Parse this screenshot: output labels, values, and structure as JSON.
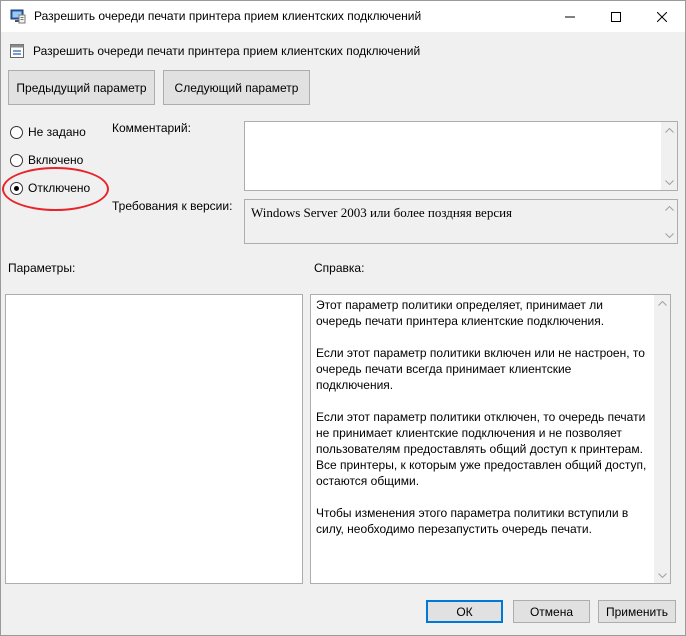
{
  "window": {
    "title": "Разрешить очереди печати принтера прием клиентских подключений"
  },
  "setting": {
    "name": "Разрешить очереди печати принтера прием клиентских подключений"
  },
  "nav": {
    "prev_label": "Предыдущий параметр",
    "next_label": "Следующий параметр"
  },
  "state": {
    "options": [
      {
        "label": "Не задано",
        "checked": false
      },
      {
        "label": "Включено",
        "checked": false
      },
      {
        "label": "Отключено",
        "checked": true
      }
    ]
  },
  "comment": {
    "label": "Комментарий:",
    "value": ""
  },
  "version": {
    "label": "Требования к версии:",
    "value": "Windows Server 2003 или более поздняя версия"
  },
  "params": {
    "label": "Параметры:"
  },
  "help": {
    "label": "Справка:",
    "paragraphs": [
      "Этот параметр политики определяет, принимает ли очередь печати принтера клиентские подключения.",
      "Если этот параметр политики включен или не настроен, то очередь печати всегда принимает клиентские подключения.",
      "Если этот параметр политики отключен, то очередь печати не принимает клиентские подключения и не позволяет пользователям предоставлять общий доступ к принтерам. Все принтеры, к которым уже предоставлен общий доступ, остаются общими.",
      "Чтобы изменения этого параметра политики вступили в силу, необходимо перезапустить очередь печати."
    ]
  },
  "footer": {
    "ok_label": "ОК",
    "cancel_label": "Отмена",
    "apply_label": "Применить"
  },
  "colors": {
    "highlight": "#e8242b",
    "accent": "#0078d7"
  },
  "icons": [
    "policy-window-icon",
    "minimize-icon",
    "maximize-icon",
    "close-icon",
    "policy-setting-icon",
    "scroll-up-icon",
    "scroll-down-icon"
  ]
}
